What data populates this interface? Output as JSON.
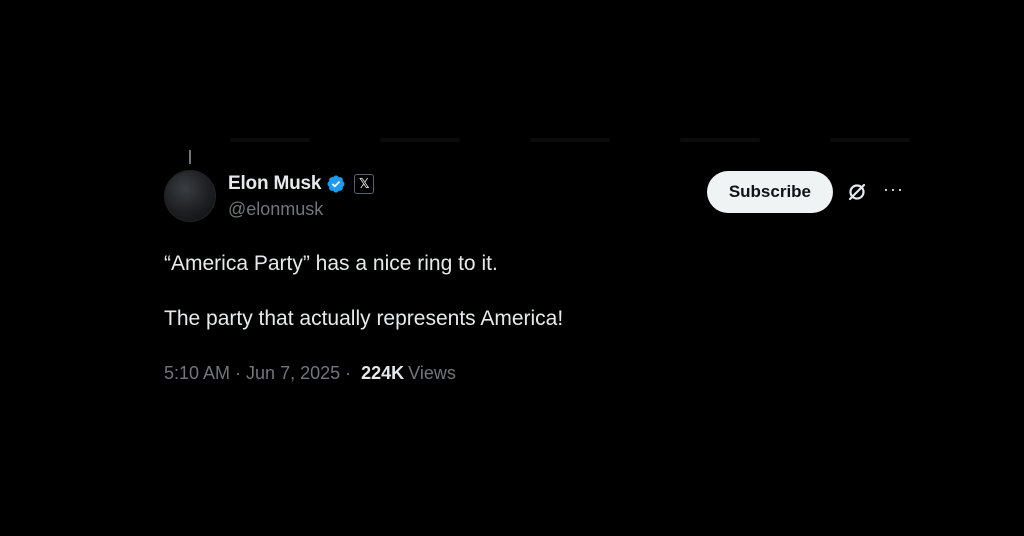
{
  "author": {
    "display_name": "Elon Musk",
    "handle": "@elonmusk",
    "badge_icon": "verified-badge-icon",
    "badge_color": "#1d9bf0",
    "affiliate_badge": "𝕏"
  },
  "actions": {
    "subscribe_label": "Subscribe",
    "grok_icon": "grok-icon",
    "more_label": "···"
  },
  "tweet": {
    "line1": "“America Party” has a nice ring to it.",
    "line2": "The party that actually represents America!"
  },
  "meta": {
    "time": "5:10 AM",
    "separator1": "·",
    "date": "Jun 7, 2025",
    "separator2": "·",
    "views_count": "224K",
    "views_label": "Views"
  },
  "colors": {
    "background": "#000000",
    "primary_text": "#e7e9ea",
    "secondary_text": "#71767b",
    "button_bg": "#eff3f4",
    "button_text": "#0f1419"
  }
}
